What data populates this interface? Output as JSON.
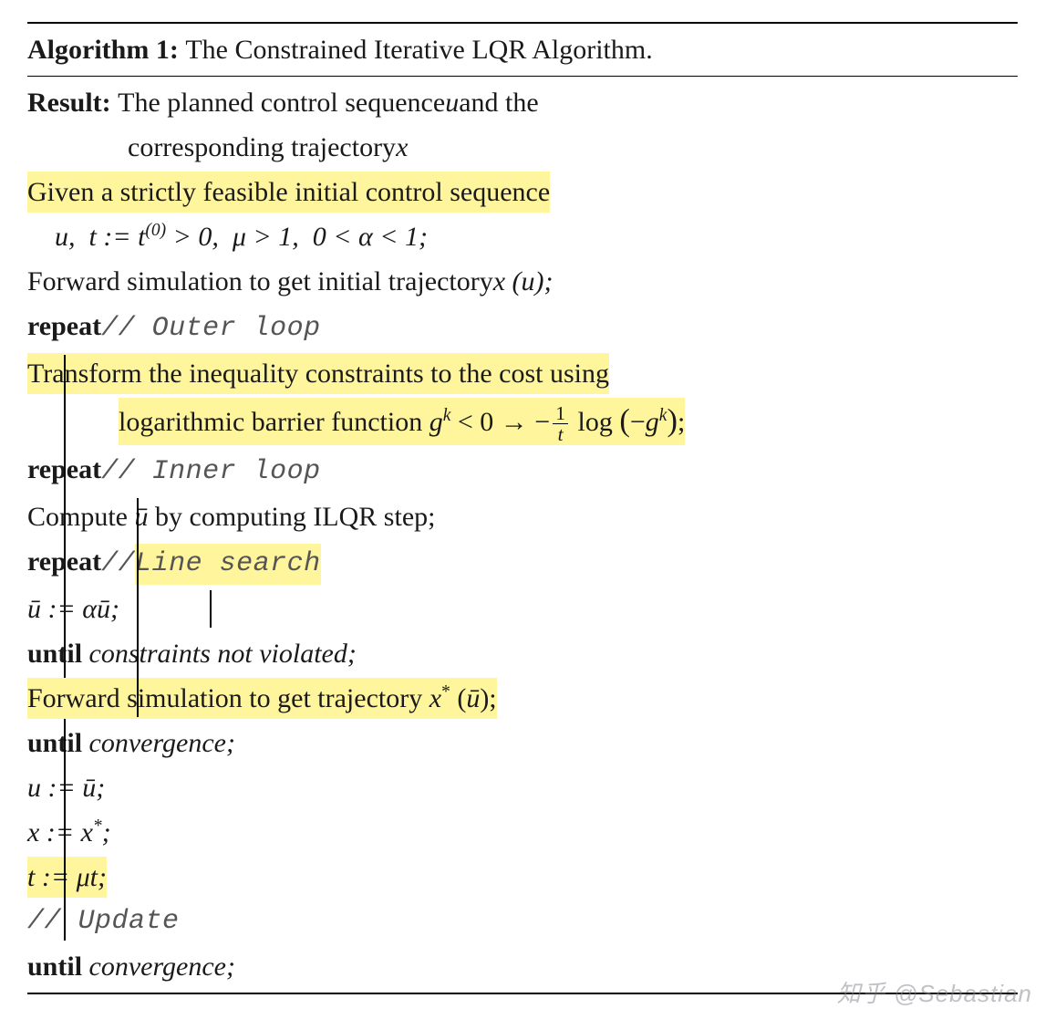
{
  "header": {
    "algo_label": "Algorithm 1:",
    "title": "The Constrained Iterative LQR Algorithm."
  },
  "result": {
    "label": "Result:",
    "text1": "The planned control sequence ",
    "u": "u",
    "text2": " and the",
    "text3": "corresponding trajectory ",
    "x": "x"
  },
  "given": {
    "text": "Given a strictly feasible initial control sequence",
    "init_math": "u,  t := t⁽⁰⁾ > 0,  μ > 1,  0 < α < 1;"
  },
  "forward_init": {
    "text": "Forward simulation to get initial trajectory ",
    "math": "x (u);"
  },
  "outer": {
    "repeat": "repeat",
    "comment": "// Outer loop",
    "transform1": "Transform the inequality constraints to the cost using",
    "transform2_a": "logarithmic barrier function ",
    "gk_lt": "gᵏ < 0 → −",
    "frac_num": "1",
    "frac_den": "t",
    "log_part": " log (−gᵏ);",
    "until": "until",
    "until_cond": "convergence;"
  },
  "inner": {
    "repeat": "repeat",
    "comment": "// Inner loop",
    "compute": "Compute ū by computing ILQR step;",
    "until": "until",
    "until_cond": "convergence;",
    "forward": "Forward simulation to get trajectory ",
    "forward_math": "x* (ū);"
  },
  "linesearch": {
    "repeat": "repeat",
    "comment": "// Line search",
    "step": "ū := αū;",
    "until": "until",
    "until_cond": "constraints not violated;"
  },
  "updates": {
    "u": "u := ū;",
    "x": "x := x*;",
    "t": "t := μt;",
    "comment": "// Update"
  },
  "watermark": "知乎 @Sebastian"
}
